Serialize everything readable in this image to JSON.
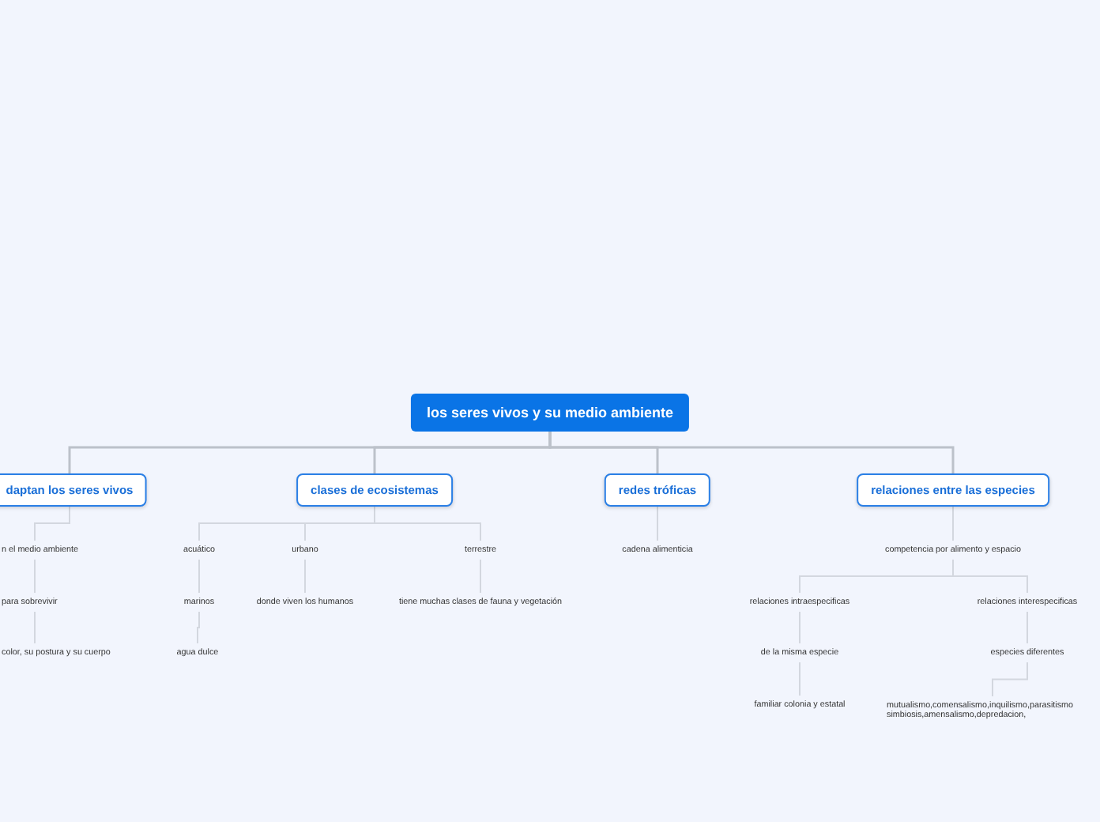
{
  "map": {
    "text": "los seres vivos y su medio ambiente",
    "children": [
      {
        "text": "daptan los seres vivos",
        "children": [
          {
            "text": "n el medio ambiente",
            "children": [
              {
                "text": "para sobrevivir",
                "children": [
                  {
                    "text": "color, su postura y su cuerpo"
                  }
                ]
              }
            ]
          }
        ]
      },
      {
        "text": "clases de ecosistemas",
        "children": [
          {
            "text": "acuático",
            "children": [
              {
                "text": "marinos",
                "children": [
                  {
                    "text": "agua dulce"
                  }
                ]
              }
            ]
          },
          {
            "text": "urbano",
            "children": [
              {
                "text": "donde viven los humanos"
              }
            ]
          },
          {
            "text": "terrestre",
            "children": [
              {
                "text": "tiene muchas clases de fauna y vegetación"
              }
            ]
          }
        ]
      },
      {
        "text": "redes tróficas",
        "children": [
          {
            "text": "cadena alimenticia"
          }
        ]
      },
      {
        "text": "relaciones entre las especies",
        "children": [
          {
            "text": "competencia por alimento y espacio",
            "children": [
              {
                "text": "relaciones  intraespecificas",
                "children": [
                  {
                    "text": "de la misma especie",
                    "children": [
                      {
                        "text": "familiar colonia y estatal"
                      }
                    ]
                  }
                ]
              },
              {
                "text": "relaciones interespecificas",
                "children": [
                  {
                    "text": "especies diferentes",
                    "children": [
                      {
                        "text": "mutualismo,comensalismo,inquilismo,parasitismo simbiosis,amensalismo,depredacion,"
                      }
                    ]
                  }
                ]
              }
            ]
          }
        ]
      }
    ]
  }
}
